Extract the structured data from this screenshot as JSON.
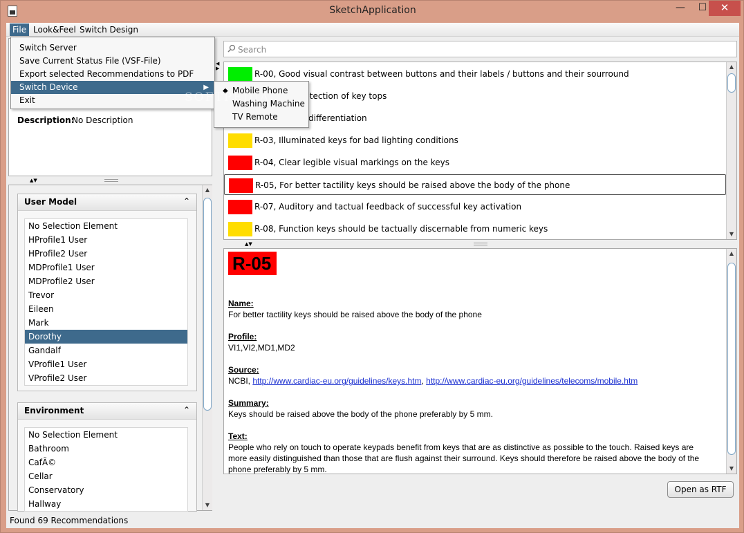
{
  "window": {
    "title": "SketchApplication",
    "minimize": "—",
    "maximize": "☐",
    "close": "✕"
  },
  "menubar": {
    "file": "File",
    "lookfeel": "Look&Feel",
    "switch_design": "Switch Design"
  },
  "file_menu": {
    "items": [
      "Switch Server",
      "Save Current Status File (VSF-File)",
      "Export selected Recommendations to PDF",
      "Switch Device",
      "Exit"
    ],
    "submenu_arrow": "▶"
  },
  "device_submenu": {
    "items": [
      "Mobile Phone",
      "Washing Machine",
      "TV Remote"
    ],
    "selected_marker": "◆"
  },
  "description": {
    "label": "Description:",
    "value": "No Description"
  },
  "user_model": {
    "title": "User Model",
    "collapse": "⌃",
    "items": [
      "No Selection Element",
      "HProfile1 User",
      "HProfile2 User",
      "MDProfile1 User",
      "MDProfile2 User",
      "Trevor",
      "Eileen",
      "Mark",
      "Dorothy",
      "Gandalf",
      "VProfile1 User",
      "VProfile2 User"
    ],
    "selected_index": 8
  },
  "environment": {
    "title": "Environment",
    "collapse": "⌃",
    "items": [
      "No Selection Element",
      "Bathroom",
      "CafÃ©",
      "Cellar",
      "Conservatory",
      "Hallway"
    ]
  },
  "search": {
    "placeholder": "Search"
  },
  "recommendations": [
    {
      "text": "R-00, Good visual contrast between buttons and their labels / buttons and their sourround",
      "color": "#00ee00"
    },
    {
      "text": "the tactile detection of key tops",
      "color": "#ff0000"
    },
    {
      "text": "ys for better differentiation",
      "color": "#ff0000"
    },
    {
      "text": "R-03, Illuminated keys for bad lighting conditions",
      "color": "#ffdd00"
    },
    {
      "text": "R-04, Clear legible visual markings on the keys",
      "color": "#ff0000"
    },
    {
      "text": "R-05, For better tactility keys should be raised above the body of the phone",
      "color": "#ff0000"
    },
    {
      "text": "R-07, Auditory and tactual feedback of successful key activation",
      "color": "#ff0000"
    },
    {
      "text": "R-08, Function keys should be tactually discernable from numeric keys",
      "color": "#ffdd00"
    }
  ],
  "detail": {
    "id": "R-05",
    "name_label": "Name:",
    "name": "For better tactility keys should be raised above the body of the phone",
    "profile_label": "Profile:",
    "profile": "VI1,VI2,MD1,MD2",
    "source_label": "Source:",
    "source_prefix": "NCBI, ",
    "source_link1": "http://www.cardiac-eu.org/guidelines/keys.htm",
    "source_sep": ", ",
    "source_link2": "http://www.cardiac-eu.org/guidelines/telecoms/mobile.htm",
    "summary_label": "Summary:",
    "summary": "Keys should be raised above the body of the phone preferably by 5 mm.",
    "text_label": "Text:",
    "text_line1": "People who rely on touch to operate keypads benefit from keys that are as distinctive as possible to the touch. Raised keys are",
    "text_line2": "more easily distinguished than those that are flush against their surround. Keys should therefore be raised above the body of the",
    "text_line3": "phone preferably by 5 mm."
  },
  "open_rtf": "Open as RTF",
  "status": "Found 69 Recommendations",
  "watermark": "SOFTPEDIA"
}
